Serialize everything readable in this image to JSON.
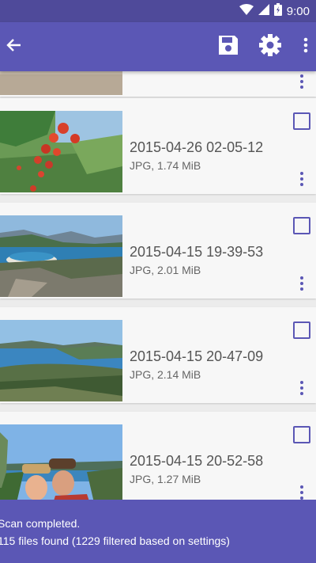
{
  "status_bar": {
    "time": "9:00"
  },
  "app_bar": {
    "back_icon": "arrow-left-icon",
    "save_icon": "save-icon",
    "settings_icon": "gear-icon",
    "more_icon": "more-vertical-icon"
  },
  "colors": {
    "primary": "#5b57b5",
    "primary_dark": "#4f4a9a",
    "card_bg": "#f7f7f7",
    "list_bg": "#ececec"
  },
  "files": [
    {
      "date": "2015-04-26 02-05-12",
      "meta": "JPG, 1.74 MiB",
      "checked": false
    },
    {
      "date": "2015-04-15 19-39-53",
      "meta": "JPG, 2.01 MiB",
      "checked": false
    },
    {
      "date": "2015-04-15 20-47-09",
      "meta": "JPG, 2.14 MiB",
      "checked": false
    },
    {
      "date": "2015-04-15 20-52-58",
      "meta": "JPG, 1.27 MiB",
      "checked": false
    }
  ],
  "footer": {
    "line1": "Scan completed.",
    "line2": "115 files found (1229 filtered based on settings)"
  }
}
